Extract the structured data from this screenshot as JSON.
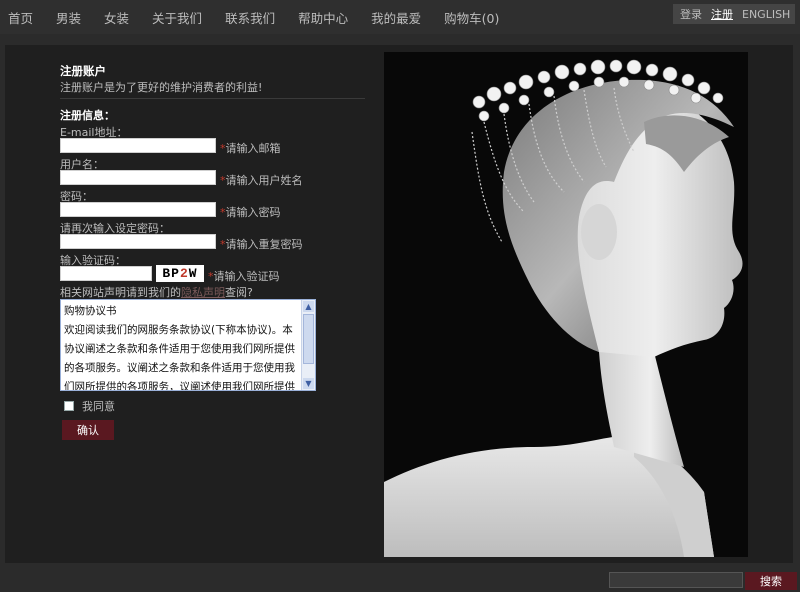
{
  "nav": {
    "items": [
      "首页",
      "男装",
      "女装",
      "关于我们",
      "联系我们",
      "帮助中心",
      "我的最爱",
      "购物车(0)"
    ],
    "account": {
      "login": "登录",
      "register": "注册",
      "english": "ENGLISH"
    }
  },
  "form": {
    "title": "注册账户",
    "subtitle": "注册账户是为了更好的维护消费者的利益!",
    "section": "注册信息：",
    "email_label": "E-mail地址：",
    "email_hint": "请输入邮箱",
    "username_label": "用户名：",
    "username_hint": "请输入用户姓名",
    "password_label": "密码：",
    "password_hint": "请输入密码",
    "password2_label": "请再次输入设定密码：",
    "password2_hint": "请输入重复密码",
    "captcha_label": "输入验证码：",
    "captcha_text_a": "BP",
    "captcha_text_b": "2",
    "captcha_text_c": "W",
    "captcha_hint": "请输入验证码",
    "privacy_prefix": "相关网站声明请到我们的",
    "privacy_link": "隐私声明",
    "privacy_suffix": "查阅?",
    "agreement_title": "购物协议书",
    "agreement_body": "欢迎阅读我们的网服务条款协议(下称本协议)。本协议阐述之条款和条件适用于您使用我们网所提供的各项服务。议阐述之条款和条件适用于您使用我们网所提供的各项服务，议阐述使用我们网所提供的各项服",
    "agree_label": "我同意",
    "confirm_label": "确认"
  },
  "search": {
    "button": "搜索"
  }
}
